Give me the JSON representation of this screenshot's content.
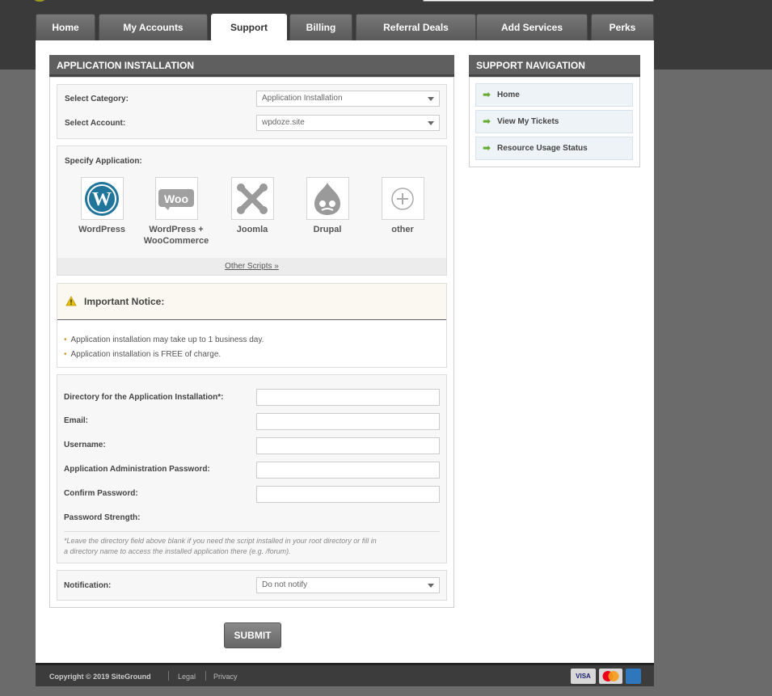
{
  "nav": {
    "tabs": [
      {
        "label": "Home"
      },
      {
        "label": "My Accounts"
      },
      {
        "label": "Support"
      },
      {
        "label": "Billing"
      },
      {
        "label": "Referral Deals"
      },
      {
        "label": "Add Services"
      },
      {
        "label": "Perks"
      }
    ],
    "active": "Support"
  },
  "main": {
    "title": "APPLICATION INSTALLATION",
    "category_label": "Select Category:",
    "category_value": "Application Installation",
    "account_label": "Select Account:",
    "account_value": "wpdoze.site",
    "specify_label": "Specify Application:",
    "apps": [
      {
        "name": "WordPress",
        "icon": "wordpress-logo-icon"
      },
      {
        "name": "WordPress + WooCommerce",
        "icon": "woocommerce-logo-icon"
      },
      {
        "name": "Joomla",
        "icon": "joomla-logo-icon"
      },
      {
        "name": "Drupal",
        "icon": "drupal-logo-icon"
      },
      {
        "name": "other",
        "icon": "plus-icon"
      }
    ],
    "other_scripts": "Other Scripts »",
    "notice": {
      "title": "Important Notice:",
      "items": [
        "Application installation may take up to 1 business day.",
        "Application installation is FREE of charge."
      ]
    },
    "form": {
      "directory_label": "Directory for the Application Installation*:",
      "directory_value": "",
      "email_label": "Email:",
      "email_value": "",
      "username_label": "Username:",
      "username_value": "",
      "password_label": "Application Administration Password:",
      "password_value": "",
      "confirm_label": "Confirm Password:",
      "confirm_value": "",
      "strength_label": "Password Strength:",
      "note_line1": "*Leave the directory field above blank if you need the script installed in your root directory or fill in",
      "note_line2": "a directory name to access the installed application there (e.g. /forum)."
    },
    "notification_label": "Notification:",
    "notification_value": "Do not notify",
    "submit_label": "SUBMIT"
  },
  "support_nav": {
    "title": "SUPPORT NAVIGATION",
    "items": [
      {
        "label": "Home"
      },
      {
        "label": "View My Tickets"
      },
      {
        "label": "Resource Usage Status"
      }
    ]
  },
  "footer": {
    "copyright": "Copyright © 2019 SiteGround",
    "legal": "Legal",
    "privacy": "Privacy",
    "cards": [
      "VISA"
    ]
  },
  "colors": {
    "header_bg": "#5f5f5f",
    "nav_arrow": "#66aa33",
    "wordpress_blue": "#21759b",
    "notice_icon": "#e8c000"
  }
}
